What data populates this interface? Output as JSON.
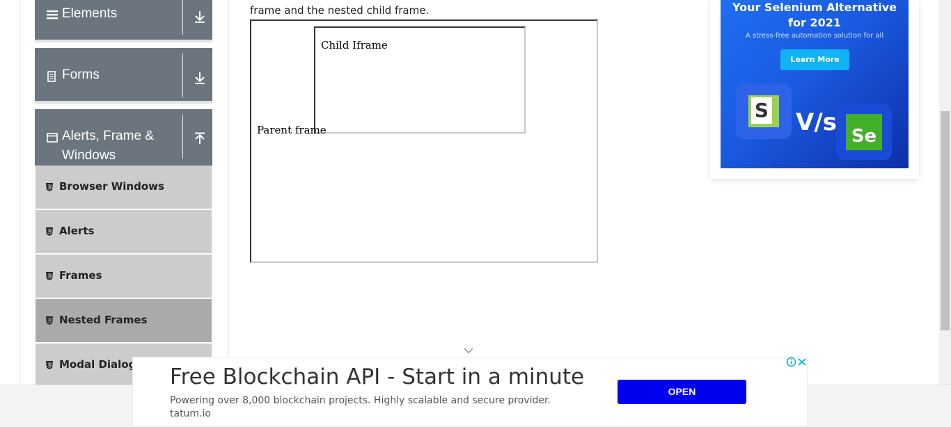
{
  "intro": {
    "line_text": "frame and the nested child frame."
  },
  "sidebar": {
    "groups": [
      {
        "title": "Elements"
      },
      {
        "title": "Forms"
      },
      {
        "title": "Alerts, Frame &",
        "title_line2": "Windows"
      }
    ],
    "items": [
      {
        "label": "Browser Windows"
      },
      {
        "label": "Alerts"
      },
      {
        "label": "Frames"
      },
      {
        "label": "Nested Frames"
      },
      {
        "label": "Modal Dialogs"
      }
    ]
  },
  "frames": {
    "parent_label": "Parent frame",
    "child_label": "Child Iframe"
  },
  "side_ad": {
    "title_line1": "Your Selenium Alternative",
    "title_line2": "for 2021",
    "subtitle": "A stress-free automation solution for all",
    "button": "Learn More",
    "vs": "V/s",
    "left_logo": "S",
    "right_logo": "Se"
  },
  "bottom_ad": {
    "title": "Free Blockchain API - Start in a minute",
    "subtitle": "Powering over 8,000 blockchain projects. Highly scalable and secure provider.",
    "url": "tatum.io",
    "button": "OPEN"
  },
  "colors": {
    "group_bg": "#6c757d",
    "item_bg": "#cccccc",
    "item_active_bg": "#aaaaaa",
    "ad_button": "#0000ee",
    "side_ad_button": "#12b3f4"
  }
}
